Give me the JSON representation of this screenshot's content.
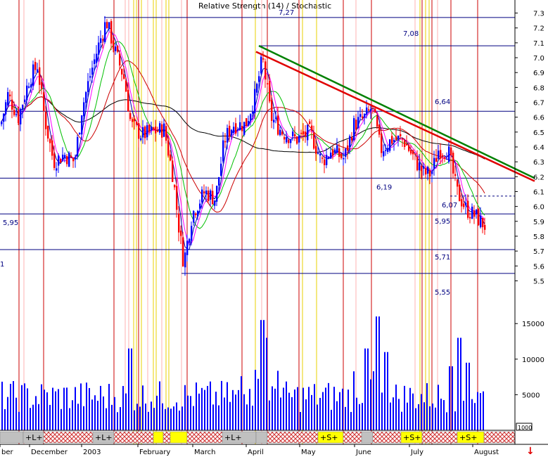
{
  "chart_data": {
    "type": "line",
    "title": "Relative Strength (14) / Stochastic",
    "price_axis": {
      "ylim": [
        5.45,
        7.35
      ],
      "ticks": [
        "7.3",
        "7.2",
        "7.1",
        "7.0",
        "6.9",
        "6.8",
        "6.7",
        "6.6",
        "6.5",
        "6.4",
        "6.3",
        "6.2",
        "6.1",
        "6.0",
        "5.9",
        "5.8",
        "5.7",
        "5.6",
        "5.5"
      ]
    },
    "volume_axis": {
      "ylim": [
        0,
        17000
      ],
      "ticks": [
        "15000",
        "10000",
        "5000"
      ]
    },
    "x_labels": [
      "ber",
      "December",
      "2003",
      "February",
      "March",
      "April",
      "May",
      "June",
      "July",
      "August"
    ],
    "horizontal_levels": [
      {
        "label": "7,27",
        "value": 7.27
      },
      {
        "label": "7,08",
        "value": 7.08
      },
      {
        "label": "6,64",
        "value": 6.64
      },
      {
        "label": "6,19",
        "value": 6.19
      },
      {
        "label": "6,07",
        "value": 6.07
      },
      {
        "label": "5,95",
        "value": 5.95
      },
      {
        "label": "5,71",
        "value": 5.71
      },
      {
        "label": "5,55",
        "value": 5.55
      }
    ],
    "left_edge_labels": [
      "5,95",
      "1"
    ],
    "trendlines": [
      {
        "color": "#008000",
        "from": [
          368,
          7.08
        ],
        "to": [
          760,
          6.19
        ]
      },
      {
        "color": "#e00000",
        "from": [
          364,
          7.04
        ],
        "to": [
          760,
          6.17
        ]
      }
    ],
    "signal_bar": [
      {
        "label": "",
        "pattern": "grey"
      },
      {
        "label": "+L+",
        "pattern": "grey"
      },
      {
        "label": "",
        "pattern": "hatch"
      },
      {
        "label": "+L+",
        "pattern": "grey"
      },
      {
        "label": "",
        "pattern": "hatch"
      },
      {
        "label": "",
        "pattern": "yellow"
      },
      {
        "label": "",
        "pattern": "hatch"
      },
      {
        "label": "",
        "pattern": "yellow"
      },
      {
        "label": "",
        "pattern": "hatch"
      },
      {
        "label": "+L+",
        "pattern": "grey"
      },
      {
        "label": "",
        "pattern": "grey"
      },
      {
        "label": "",
        "pattern": "hatch"
      },
      {
        "label": "+S+",
        "pattern": "yellow"
      },
      {
        "label": "",
        "pattern": "hatch"
      },
      {
        "label": "",
        "pattern": "grey"
      },
      {
        "label": "",
        "pattern": "hatch"
      },
      {
        "label": "+S+",
        "pattern": "yellow"
      },
      {
        "label": "",
        "pattern": "hatch"
      },
      {
        "label": "+S+",
        "pattern": "yellow"
      },
      {
        "label": "",
        "pattern": "hatch"
      }
    ],
    "volume_mark": "1000",
    "arrow_glyph": "↓",
    "colors": {
      "up": "#0000ff",
      "down": "#ff0000",
      "ma_fast": "#0000aa",
      "ma_magenta": "#ff00ff",
      "ma_green": "#00c000",
      "ma_red": "#cc0000",
      "ma_black": "#000000",
      "vline_red": "#cc0000",
      "vline_yellow": "#e8d000",
      "vline_pink": "#ffb0b0",
      "hline": "#000080"
    }
  }
}
